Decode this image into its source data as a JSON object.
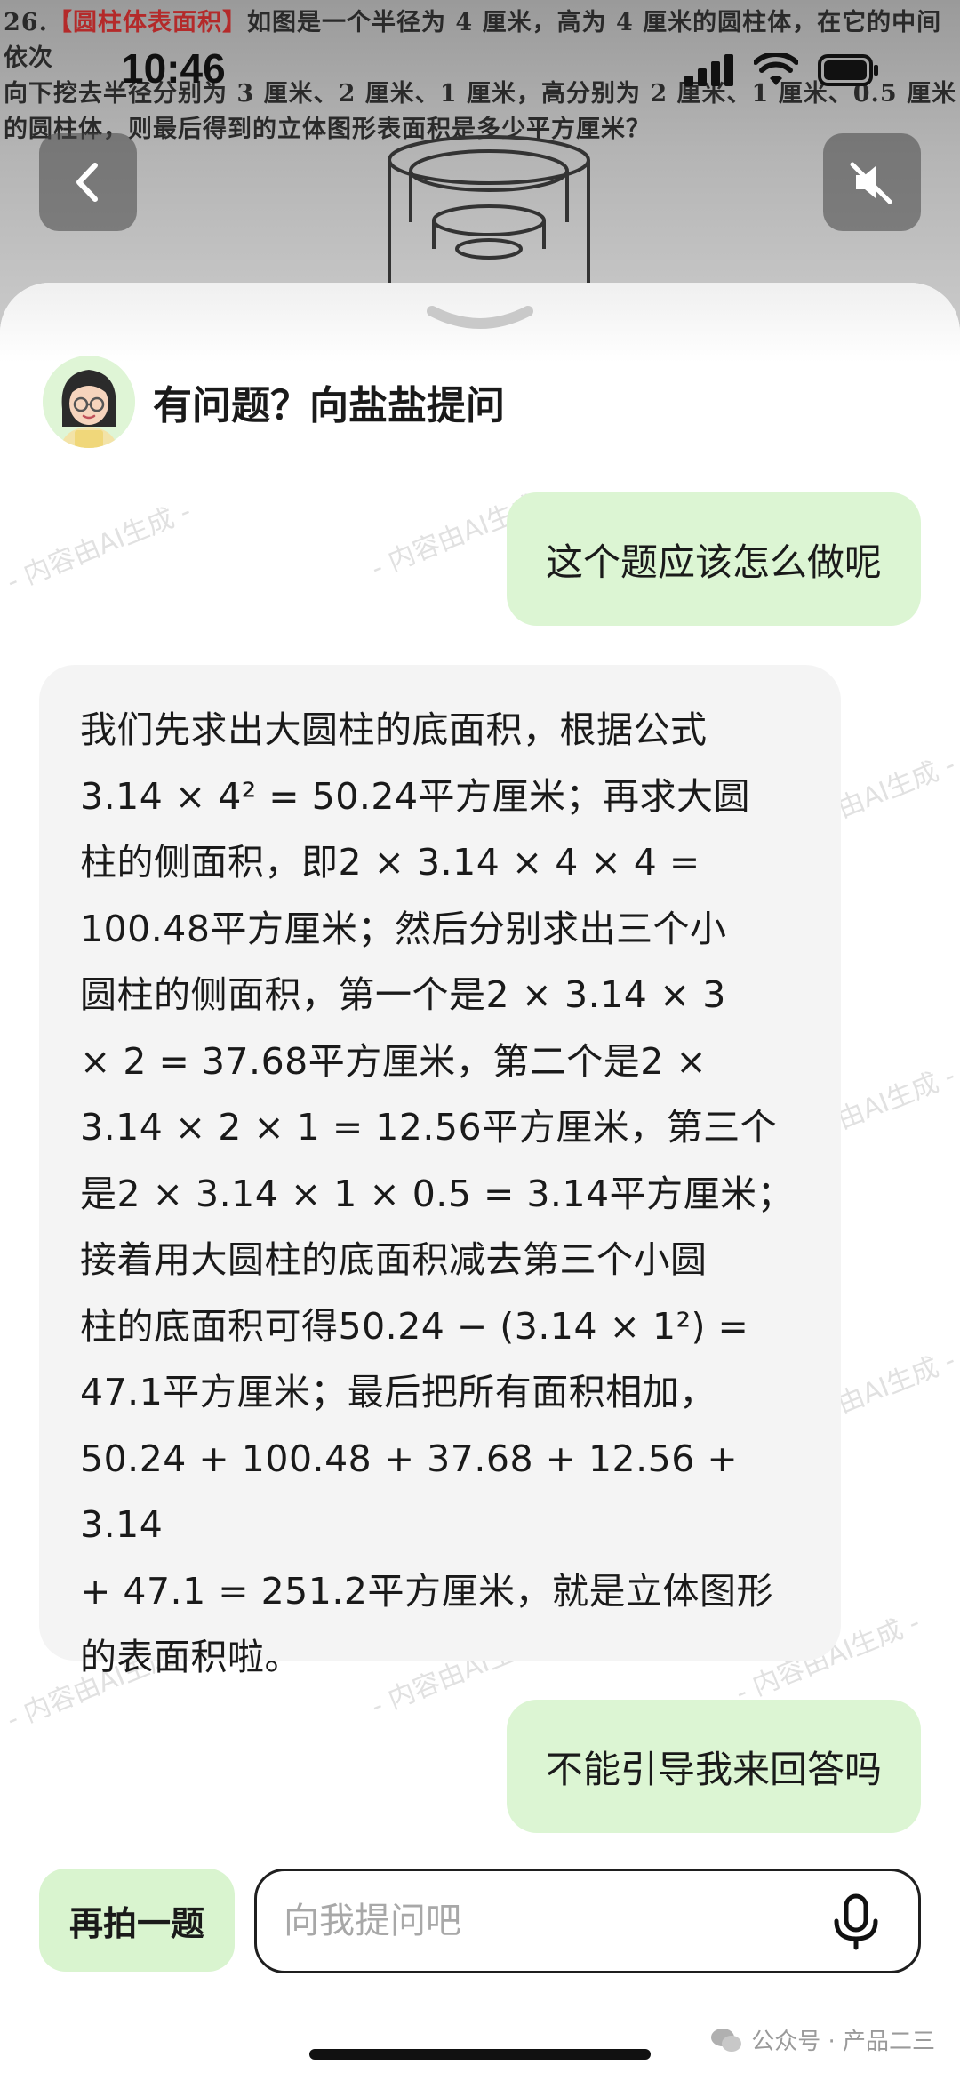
{
  "photo": {
    "question_line1_num": "26.",
    "question_line1_tag": "【圆柱体表面积】",
    "question_line1_text": "如图是一个半径为 4 厘米，高为 4 厘米的圆柱体，在它的中间依次",
    "question_line2": "向下挖去半径分别为 3 厘米、2 厘米、1 厘米，高分别为 2 厘米、1 厘米、0.5 厘米",
    "question_line3": "的圆柱体，则最后得到的立体图形表面积是多少平方厘米？"
  },
  "status_bar": {
    "time": "10:46"
  },
  "sheet": {
    "title": "有问题？向盐盐提问",
    "watermark": "- 内容由AI生成 -"
  },
  "messages": {
    "user_1": "这个题应该怎么做呢",
    "ai_1": {
      "lines": [
        "我们先求出大圆柱的底面积，根据公式",
        "3.14 × 4² = 50.24平方厘米；再求大圆",
        "柱的侧面积，即2 × 3.14 × 4 × 4 =",
        "100.48平方厘米；然后分别求出三个小",
        "圆柱的侧面积，第一个是2 × 3.14 × 3",
        "× 2 = 37.68平方厘米，第二个是2 ×",
        "3.14 × 2 × 1 = 12.56平方厘米，第三个",
        "是2 × 3.14 × 1 × 0.5 = 3.14平方厘米；",
        "接着用大圆柱的底面积减去第三个小圆",
        "柱的底面积可得50.24 − (3.14 × 1²) =",
        "47.1平方厘米；最后把所有面积相加，",
        "50.24 + 100.48 + 37.68 + 12.56 + 3.14",
        "+ 47.1 = 251.2平方厘米，就是立体图形",
        "的表面积啦。"
      ]
    },
    "user_2": "不能引导我来回答吗"
  },
  "composer": {
    "retake_label": "再拍一题",
    "input_placeholder": "向我提问吧",
    "input_value": ""
  },
  "footer": {
    "wechat_mark": "公众号 · 产品二三"
  },
  "colors": {
    "user_bubble": "#dcf5d3",
    "ai_bubble": "#f4f4f4",
    "retake_button": "#d9f4cf"
  },
  "icons": {
    "back": "chevron-left-icon",
    "mute": "speaker-muted-icon",
    "mic": "microphone-icon",
    "handle": "chevron-down-icon",
    "signal": "cellular-signal-icon",
    "wifi": "wifi-icon",
    "battery": "battery-icon"
  }
}
